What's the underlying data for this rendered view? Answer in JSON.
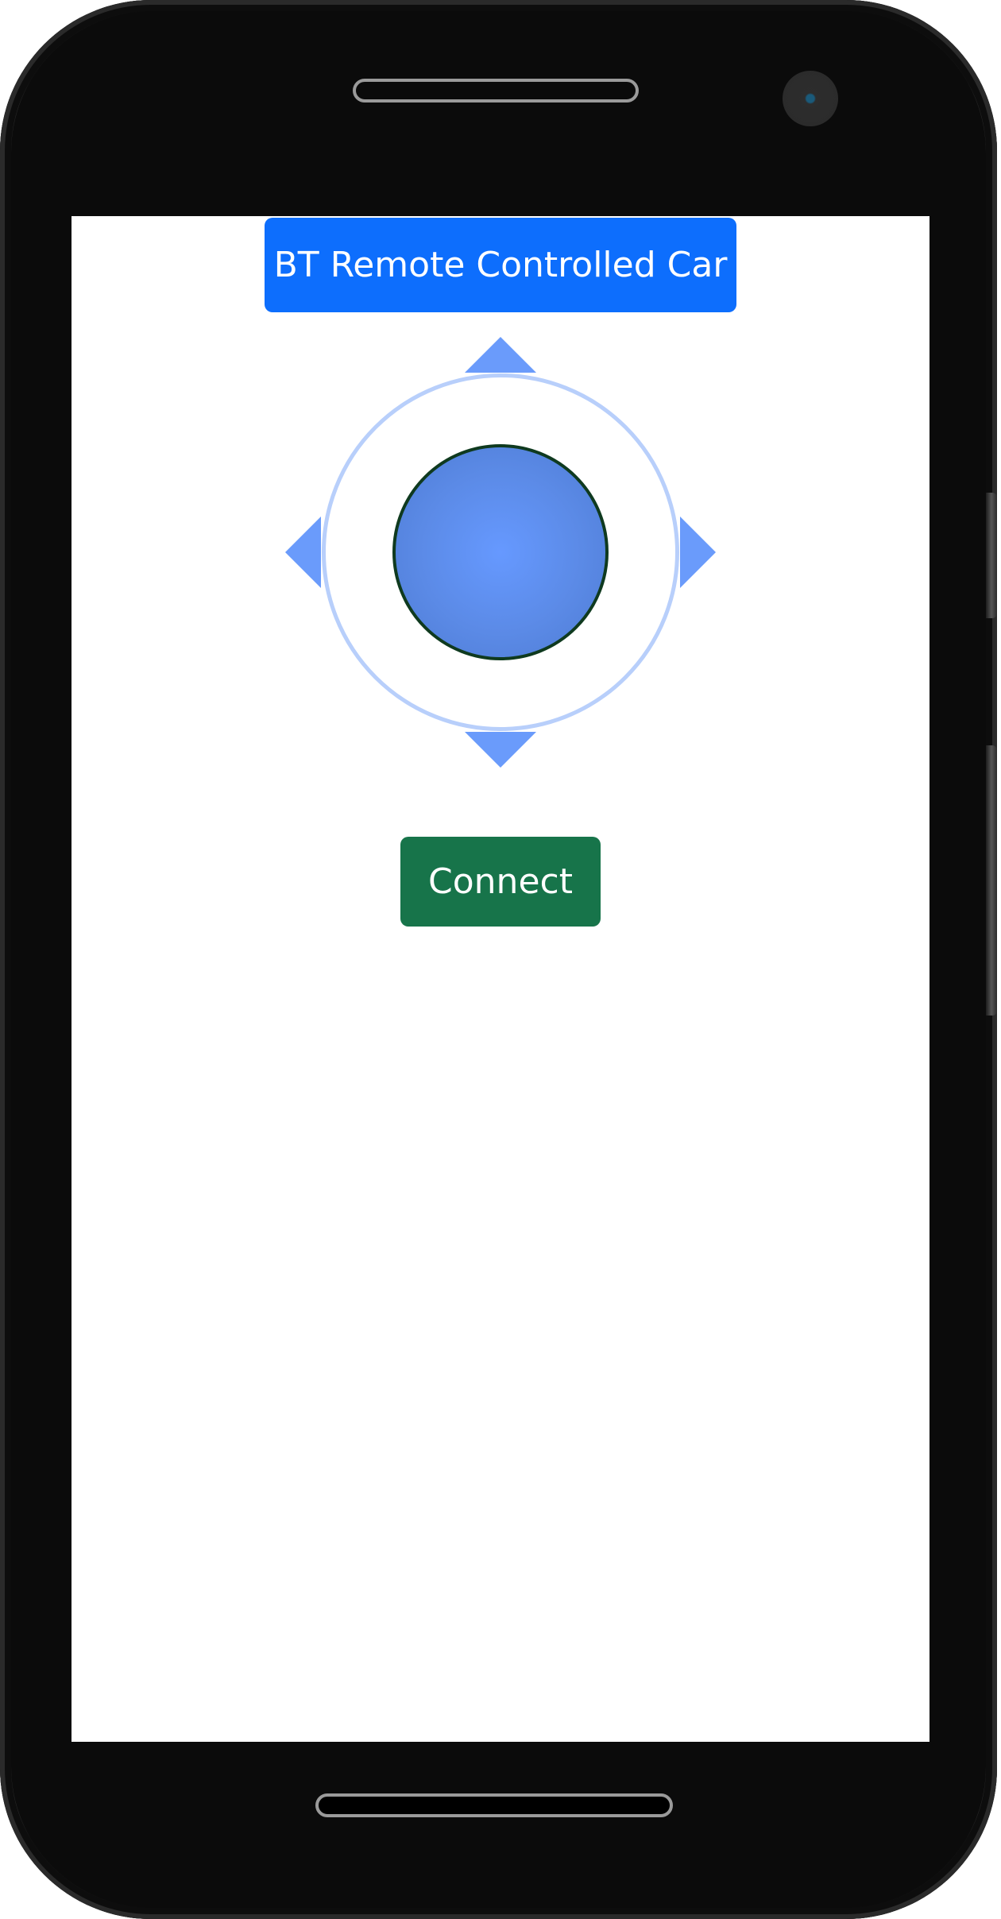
{
  "app": {
    "title": "BT Remote Controlled Car"
  },
  "joystick": {
    "knob_color": "#6699ff",
    "arrow_color": "#6a9bfb",
    "ring_color": "#b8cffb",
    "icons": [
      "arrow-up-icon",
      "arrow-down-icon",
      "arrow-left-icon",
      "arrow-right-icon"
    ]
  },
  "actions": {
    "connect_label": "Connect",
    "connect_color": "#17744a"
  },
  "theme": {
    "primary": "#0d6efd",
    "success": "#17744a"
  }
}
